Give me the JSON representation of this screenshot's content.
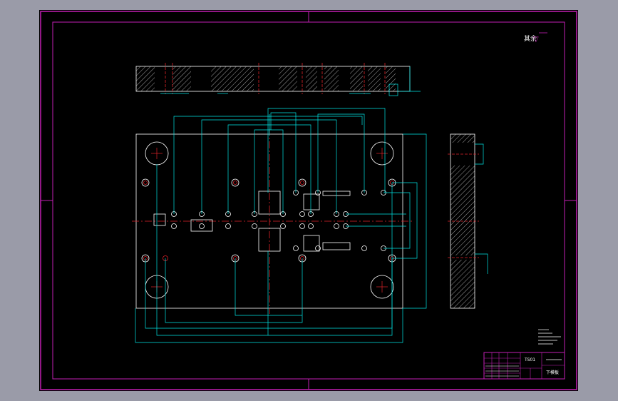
{
  "colors": {
    "app_background": "#9a9ba8",
    "model_background": "#000000",
    "border": "#c21fb3",
    "geometry": "#ffffff",
    "dimension": "#00e5e5",
    "centerline": "#e0232a",
    "hatch": "#c9c9c9"
  },
  "drawing": {
    "roughness_note": "其余",
    "roughness_symbol": "▽",
    "title_block": {
      "drawing_no": "TS01",
      "part_name": "下模板"
    }
  },
  "icons": [
    "roughness-symbol-icon"
  ]
}
